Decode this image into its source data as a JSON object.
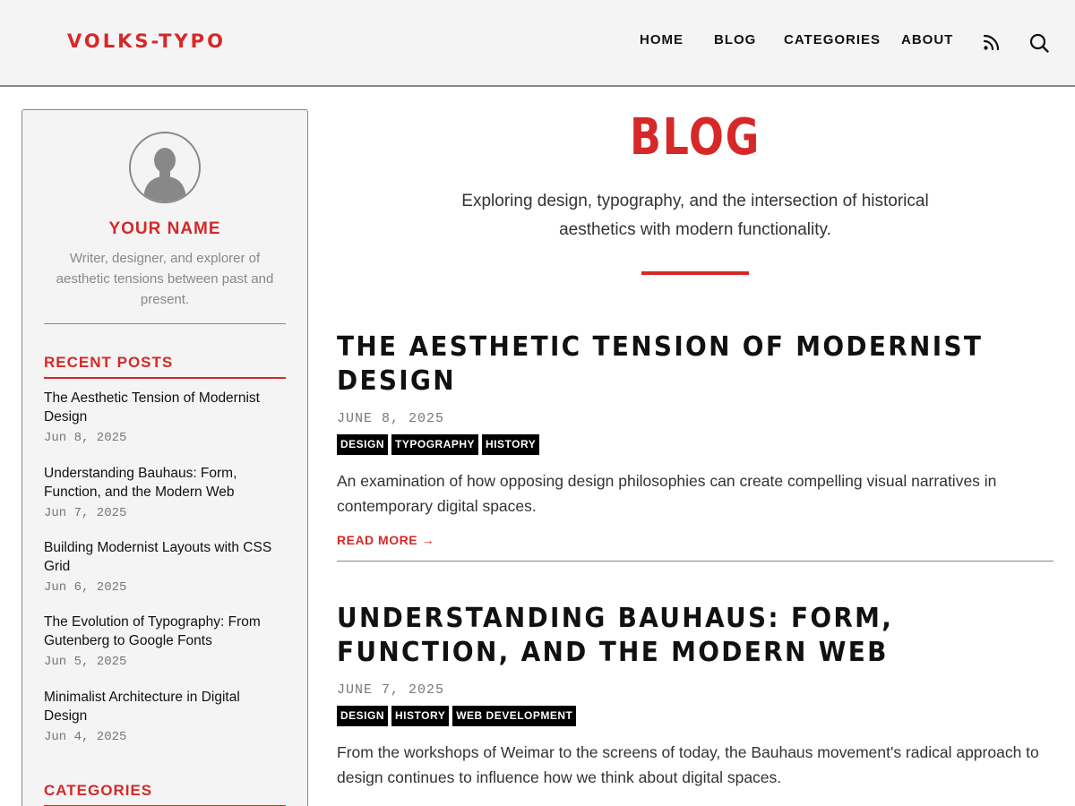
{
  "site": {
    "logo": "VOLKS-TYPO",
    "accent_color": "#d62828"
  },
  "nav": {
    "items": [
      {
        "label": "HOME"
      },
      {
        "label": "BLOG"
      },
      {
        "label": "CATEGORIES"
      },
      {
        "label": "ABOUT"
      }
    ],
    "icons": [
      "rss-icon",
      "search-icon"
    ]
  },
  "sidebar": {
    "avatar_icon": "user-avatar-icon",
    "author_name": "YOUR NAME",
    "author_bio": "Writer, designer, and explorer of aesthetic tensions between past and present.",
    "recent_posts_title": "RECENT POSTS",
    "recent_posts": [
      {
        "title": "The Aesthetic Tension of Modernist Design",
        "date": "Jun 8, 2025"
      },
      {
        "title": "Understanding Bauhaus: Form, Function, and the Modern Web",
        "date": "Jun 7, 2025"
      },
      {
        "title": "Building Modernist Layouts with CSS Grid",
        "date": "Jun 6, 2025"
      },
      {
        "title": "The Evolution of Typography: From Gutenberg to Google Fonts",
        "date": "Jun 5, 2025"
      },
      {
        "title": "Minimalist Architecture in Digital Design",
        "date": "Jun 4, 2025"
      }
    ],
    "categories_title": "CATEGORIES"
  },
  "main": {
    "page_title": "BLOG",
    "page_description": "Exploring design, typography, and the intersection of historical aesthetics with modern functionality.",
    "posts": [
      {
        "title": "THE AESTHETIC TENSION OF MODERNIST DESIGN",
        "date": "JUNE 8, 2025",
        "tags": [
          "DESIGN",
          "TYPOGRAPHY",
          "HISTORY"
        ],
        "excerpt": "An examination of how opposing design philosophies can create compelling visual narratives in contemporary digital spaces.",
        "read_more": "READ MORE →"
      },
      {
        "title": "UNDERSTANDING BAUHAUS: FORM, FUNCTION, AND THE MODERN WEB",
        "date": "JUNE 7, 2025",
        "tags": [
          "DESIGN",
          "HISTORY",
          "WEB DEVELOPMENT"
        ],
        "excerpt": "From the workshops of Weimar to the screens of today, the Bauhaus movement's radical approach to design continues to influence how we think about digital spaces."
      }
    ]
  }
}
